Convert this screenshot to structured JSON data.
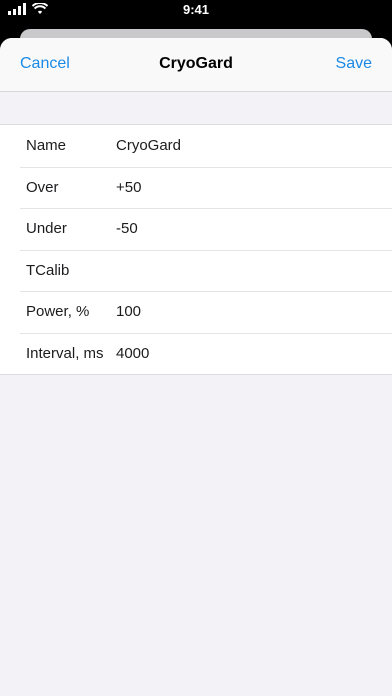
{
  "status_bar": {
    "time": "9:41"
  },
  "nav": {
    "cancel_label": "Cancel",
    "title": "CryoGard",
    "save_label": "Save"
  },
  "form": {
    "rows": [
      {
        "label": "Name",
        "value": "CryoGard"
      },
      {
        "label": "Over",
        "value": "+50"
      },
      {
        "label": "Under",
        "value": "-50"
      },
      {
        "label": "TCalib",
        "value": ""
      },
      {
        "label": "Power, %",
        "value": "100"
      },
      {
        "label": "Interval, ms",
        "value": "4000"
      }
    ]
  },
  "colors": {
    "accent": "#1a8ae6",
    "background": "#f2f2f7"
  }
}
